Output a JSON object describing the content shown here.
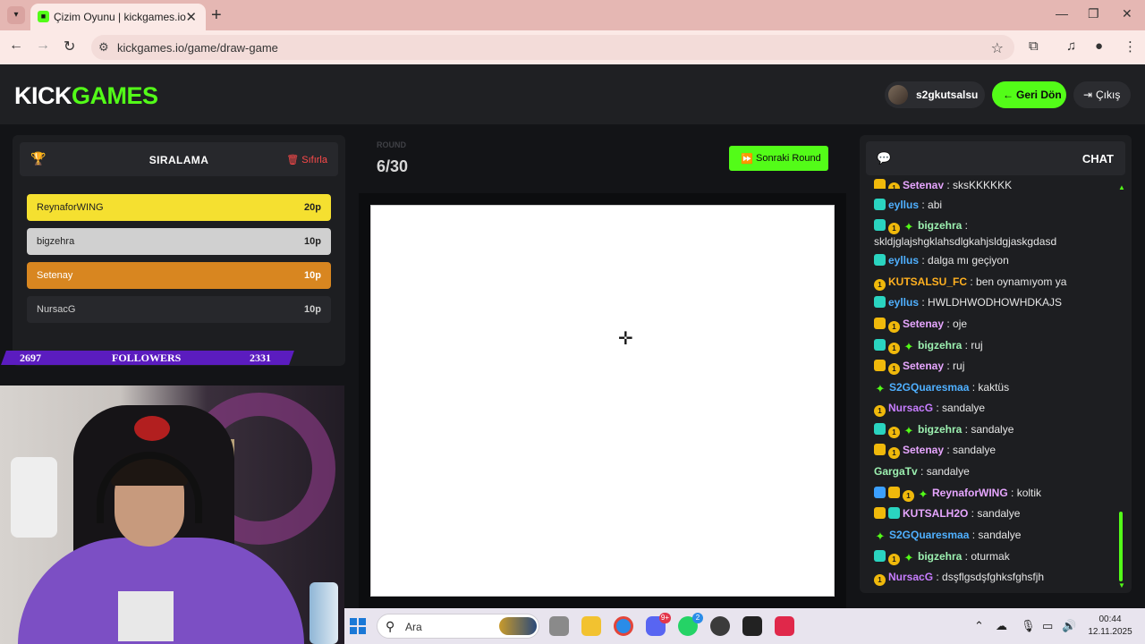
{
  "browser": {
    "tab_title": "Çizim Oyunu | kickgames.io",
    "url": "kickgames.io/game/draw-game"
  },
  "header": {
    "logo_part1": "KICK",
    "logo_part2": "GAMES",
    "username": "s2gkutsalsu",
    "back_label": "Geri Dön",
    "exit_label": "Çıkış"
  },
  "leaderboard": {
    "title": "SIRALAMA",
    "reset_label": "Sıfırla",
    "rows": [
      {
        "name": "ReynaforWING",
        "score": "20p"
      },
      {
        "name": "bigzehra",
        "score": "10p"
      },
      {
        "name": "Setenay",
        "score": "10p"
      },
      {
        "name": "NursacG",
        "score": "10p"
      }
    ]
  },
  "followers": {
    "left": "2697",
    "label": "FOLLOWERS",
    "right": "2331"
  },
  "game": {
    "round_label": "ROUND",
    "round_value": "6/30",
    "next_round_label": "Sonraki Round"
  },
  "chat": {
    "title": "CHAT",
    "messages": [
      {
        "user": "Setenay",
        "text": "sksKKKKKK"
      },
      {
        "user": "eyllus",
        "text": "abi"
      },
      {
        "user": "bigzehra",
        "text": "skldjglajshgklahsdlgkahjsldgjaskgdasd"
      },
      {
        "user": "eyllus",
        "text": "dalga mı geçiyon"
      },
      {
        "user": "KUTSALSU_FC",
        "text": "ben oynamıyom ya"
      },
      {
        "user": "eyllus",
        "text": "HWLDHWODHOWHDKAJS"
      },
      {
        "user": "Setenay",
        "text": "oje"
      },
      {
        "user": "bigzehra",
        "text": "ruj"
      },
      {
        "user": "Setenay",
        "text": "ruj"
      },
      {
        "user": "S2GQuaresmaa",
        "text": "kaktüs"
      },
      {
        "user": "NursacG",
        "text": "sandalye"
      },
      {
        "user": "bigzehra",
        "text": "sandalye"
      },
      {
        "user": "Setenay",
        "text": "sandalye"
      },
      {
        "user": "GargaTv",
        "text": "sandalye"
      },
      {
        "user": "ReynaforWING",
        "text": "koltik"
      },
      {
        "user": "KUTSALH2O",
        "text": "sandalye"
      },
      {
        "user": "S2GQuaresmaa",
        "text": "sandalye"
      },
      {
        "user": "bigzehra",
        "text": "oturmak"
      },
      {
        "user": "NursacG",
        "text": "dsşflgsdşfghksfghsfjh"
      }
    ]
  },
  "taskbar": {
    "search_placeholder": "Ara",
    "discord_badge": "9+",
    "whatsapp_badge": "2",
    "time": "00:44",
    "date": "12.11.2025"
  },
  "colors": {
    "accent": "#53fc18",
    "gold": "#f5e030",
    "silver": "#cfcfcf",
    "bronze": "#d88620"
  }
}
